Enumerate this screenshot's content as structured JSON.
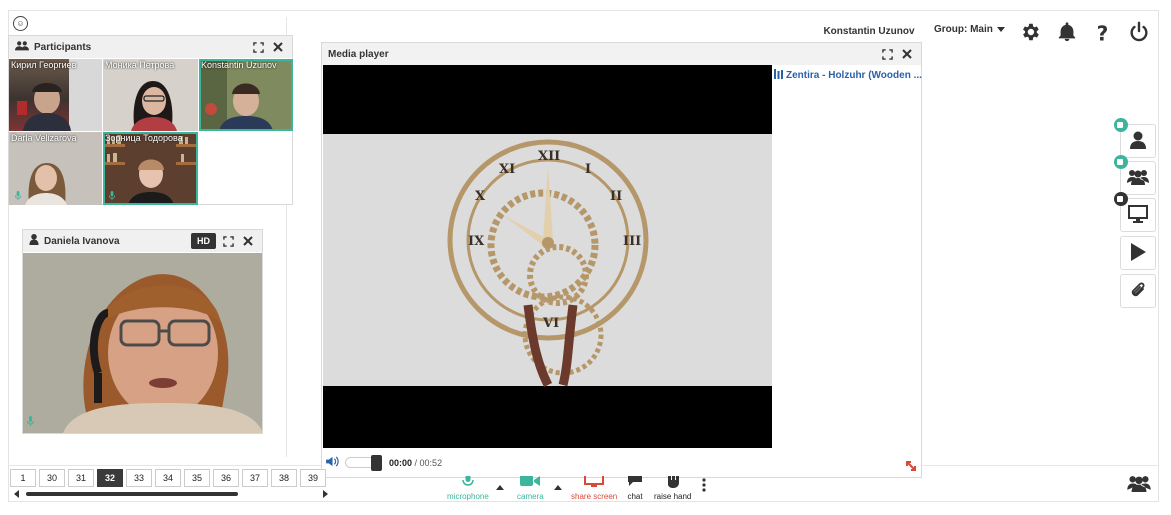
{
  "header": {
    "user_name": "Konstantin Uzunov",
    "group_label": "Group: Main"
  },
  "participants": {
    "title": "Participants",
    "tiles": [
      {
        "name": "Кирил Георгиев"
      },
      {
        "name": "Моника Петрова"
      },
      {
        "name": "Konstantin Uzunov"
      },
      {
        "name": "Darla Velizarova"
      },
      {
        "name": "Зорница Тодорова"
      }
    ]
  },
  "speaker": {
    "name": "Daniela Ivanova",
    "hd_label": "HD"
  },
  "media_player": {
    "title": "Media player",
    "playlist_item": "Zentira - Holzuhr (Wooden ...",
    "time_current": "00:00",
    "time_separator": " / ",
    "time_total": "00:52",
    "playback_progress": 0
  },
  "pager": {
    "pages": [
      "1",
      "30",
      "31",
      "32",
      "33",
      "34",
      "35",
      "36",
      "37",
      "38",
      "39"
    ],
    "current": "32"
  },
  "actions": {
    "microphone": "microphone",
    "camera": "camera",
    "share_screen": "share screen",
    "chat": "chat",
    "raise_hand": "raise hand"
  },
  "colors": {
    "accent_green": "#3bb59b",
    "share_red": "#d84a38",
    "link_blue": "#2a62a8",
    "dark": "#333333"
  },
  "icons": {
    "settings": "gear-icon",
    "notifications": "bell-icon",
    "help": "question-icon",
    "power": "power-icon",
    "side_user": "user-icon",
    "side_group": "users-icon",
    "side_screen": "monitor-icon",
    "side_play": "play-icon",
    "side_attach": "paperclip-icon"
  }
}
